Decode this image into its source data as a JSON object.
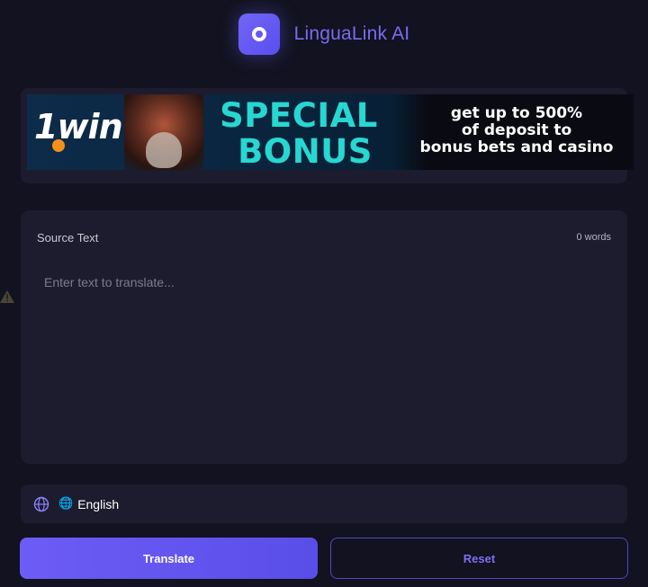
{
  "header": {
    "app_title": "LinguaLink AI",
    "logo_icon": "ring-logo-icon"
  },
  "ad": {
    "brand": "1win",
    "headline_line1": "SPECIAL",
    "headline_line2": "BONUS",
    "subtext_line1": "get up to 500%",
    "subtext_line2": "of deposit to",
    "subtext_line3": "bonus bets and casino"
  },
  "source": {
    "label": "Source Text",
    "word_count": "0 words",
    "placeholder": "Enter text to translate...",
    "value": ""
  },
  "language": {
    "icon": "globe-icon",
    "flag": "🌐",
    "selected": "English"
  },
  "actions": {
    "translate_label": "Translate",
    "reset_label": "Reset"
  },
  "colors": {
    "background": "#121220",
    "card": "#1c1c2e",
    "accent": "#6d5cf6",
    "title": "#7a6cf0",
    "ad_headline": "#27d7d2"
  }
}
